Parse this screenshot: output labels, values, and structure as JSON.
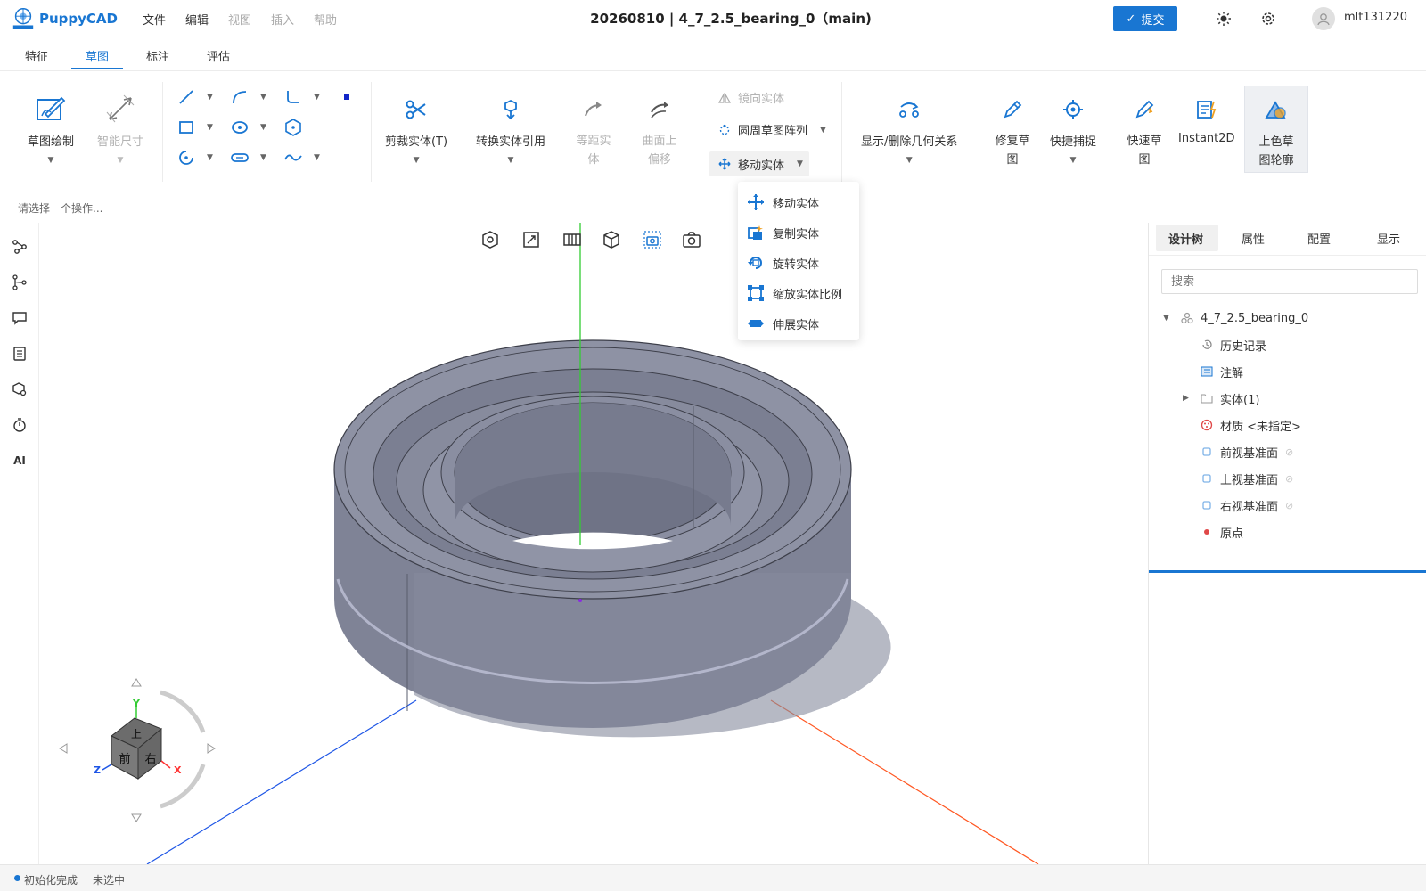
{
  "header": {
    "logo_text": "PuppyCAD",
    "menu": [
      "文件",
      "编辑",
      "视图",
      "插入",
      "帮助"
    ],
    "doc_title": "20260810 | 4_7_2.5_bearing_0（main)",
    "submit_label": "提交",
    "username": "mlt131220"
  },
  "tabs": [
    "特征",
    "草图",
    "标注",
    "评估"
  ],
  "active_tab": "草图",
  "ribbon": {
    "sketch_draw": "草图绘制",
    "smart_dim": "智能尺寸",
    "trim": "剪裁实体(T)",
    "convert": "转换实体引用",
    "offset": "等距实\n体",
    "surface_offset": "曲面上\n偏移",
    "mirror": "镜向实体",
    "circular_pattern": "圆周草图阵列",
    "move_entity": "移动实体",
    "relations": "显示/删除几何关系",
    "repair": "修复草\n图",
    "snap": "快捷捕捉",
    "quick_sketch": "快速草\n图",
    "instant2d": "Instant2D",
    "shaded": "上色草\n图轮廓"
  },
  "hint": "请选择一个操作...",
  "dropdown": {
    "items": [
      "移动实体",
      "复制实体",
      "旋转实体",
      "缩放实体比例",
      "伸展实体"
    ]
  },
  "right_panel": {
    "tabs": [
      "设计树",
      "属性",
      "配置",
      "显示"
    ],
    "search_placeholder": "搜索",
    "tree": {
      "root": "4_7_2.5_bearing_0",
      "history": "历史记录",
      "annotation": "注解",
      "solid": "实体(1)",
      "material": "材质 <未指定>",
      "front_plane": "前视基准面",
      "top_plane": "上视基准面",
      "right_plane": "右视基准面",
      "origin": "原点"
    }
  },
  "left_sidebar": {
    "ai_label": "AI"
  },
  "view_cube": {
    "top": "上",
    "front": "前",
    "right": "右",
    "axis_x": "X",
    "axis_y": "Y",
    "axis_z": "Z"
  },
  "status": {
    "init": "初始化完成",
    "selection": "未选中"
  },
  "colors": {
    "accent": "#1976d2",
    "axis_x": "#ff5722",
    "axis_y": "#33cc33",
    "axis_z": "#1e56e6",
    "model": "#7f8396"
  }
}
